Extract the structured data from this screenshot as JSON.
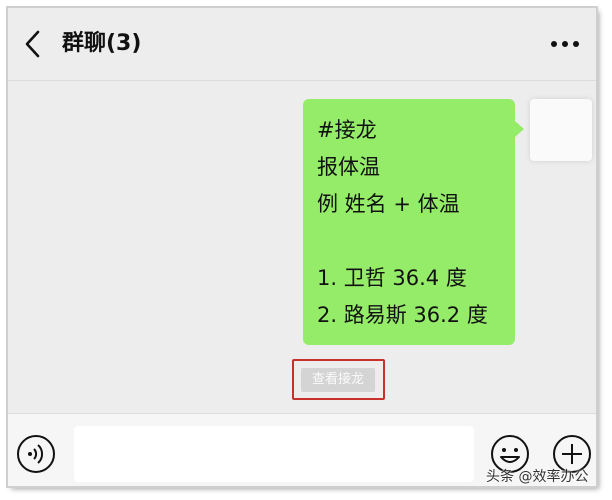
{
  "header": {
    "title": "群聊(3)",
    "back_icon": "chevron-left-icon",
    "more_icon": "ellipsis-icon"
  },
  "message": {
    "lines": [
      "#接龙",
      "报体温",
      "例 姓名 + 体温",
      "",
      "1. 卫哲 36.4 度",
      "2. 路易斯 36.2 度"
    ],
    "bubble_color": "#95ec69"
  },
  "view_button": {
    "label": "查看接龙"
  },
  "highlight_color": "#c9302c",
  "input_bar": {
    "value": "",
    "voice_icon": "voice-icon",
    "emoji_icon": "emoji-icon",
    "plus_icon": "plus-icon"
  },
  "watermark": "头条 @效率办公"
}
